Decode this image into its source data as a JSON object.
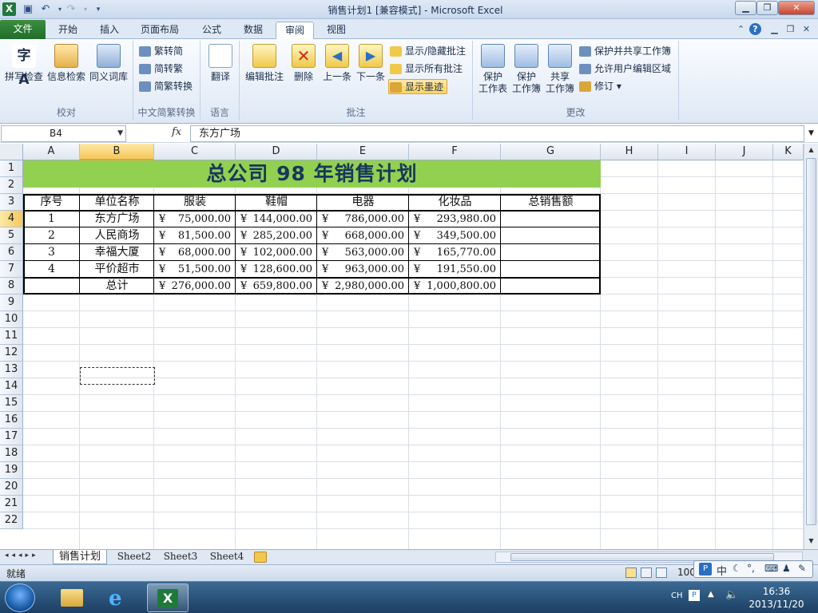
{
  "window": {
    "title": "销售计划1 [兼容模式] - Microsoft Excel",
    "app_icon": "X"
  },
  "ribbon_tabs": [
    "文件",
    "开始",
    "插入",
    "页面布局",
    "公式",
    "数据",
    "审阅",
    "视图"
  ],
  "active_tab": "审阅",
  "ribbon": {
    "proofing": {
      "label": "校对",
      "spell": "拼写检查",
      "research": "信息检索",
      "thesaurus": "同义词库"
    },
    "chinese": {
      "label": "中文简繁转换",
      "to_simplified": "繁转简",
      "to_traditional": "简转繁",
      "convert": "简繁转换"
    },
    "language": {
      "label": "语言",
      "translate": "翻译"
    },
    "comments": {
      "label": "批注",
      "edit": "编辑批注",
      "delete": "删除",
      "prev": "上一条",
      "next": "下一条",
      "show_hide": "显示/隐藏批注",
      "show_all": "显示所有批注",
      "show_ink": "显示墨迹"
    },
    "changes": {
      "label": "更改",
      "protect_sheet_1": "保护",
      "protect_sheet_2": "工作表",
      "protect_wb_1": "保护",
      "protect_wb_2": "工作簿",
      "share_wb_1": "共享",
      "share_wb_2": "工作簿",
      "protect_share": "保护并共享工作簿",
      "allow_edit": "允许用户编辑区域",
      "track": "修订 ▾"
    }
  },
  "formula_bar": {
    "name_box": "B4",
    "fx": "fx",
    "content": "东方广场"
  },
  "columns": [
    "A",
    "B",
    "C",
    "D",
    "E",
    "F",
    "G",
    "H",
    "I",
    "J",
    "K"
  ],
  "rows": [
    "1",
    "2",
    "3",
    "4",
    "5",
    "6",
    "7",
    "8",
    "9",
    "10",
    "11",
    "12",
    "13",
    "14",
    "15",
    "16",
    "17",
    "18",
    "19",
    "20",
    "21",
    "22"
  ],
  "selected_cell": "B4",
  "sheet": {
    "title": "总公司 98 年销售计划",
    "headers": [
      "序号",
      "单位名称",
      "服装",
      "鞋帽",
      "电器",
      "化妆品",
      "总销售额"
    ],
    "currency_symbol": "¥",
    "data_rows": [
      {
        "seq": "1",
        "name": "东方广场",
        "values": [
          "75,000.00",
          "144,000.00",
          "786,000.00",
          "293,980.00"
        ]
      },
      {
        "seq": "2",
        "name": "人民商场",
        "values": [
          "81,500.00",
          "285,200.00",
          "668,000.00",
          "349,500.00"
        ]
      },
      {
        "seq": "3",
        "name": "幸福大厦",
        "values": [
          "68,000.00",
          "102,000.00",
          "563,000.00",
          "165,770.00"
        ]
      },
      {
        "seq": "4",
        "name": "平价超市",
        "values": [
          "51,500.00",
          "128,600.00",
          "963,000.00",
          "191,550.00"
        ]
      }
    ],
    "total_row": {
      "label": "总计",
      "values": [
        "276,000.00",
        "659,800.00",
        "2,980,000.00",
        "1,000,800.00"
      ]
    }
  },
  "sheet_tabs": [
    "销售计划",
    "Sheet2",
    "Sheet3",
    "Sheet4"
  ],
  "active_sheet": "销售计划",
  "status": {
    "ready": "就绪",
    "zoom": "100"
  },
  "taskbar": {
    "lang": "CH",
    "time": "16:36",
    "date": "2013/11/20"
  },
  "ime": {
    "mode": "中"
  }
}
